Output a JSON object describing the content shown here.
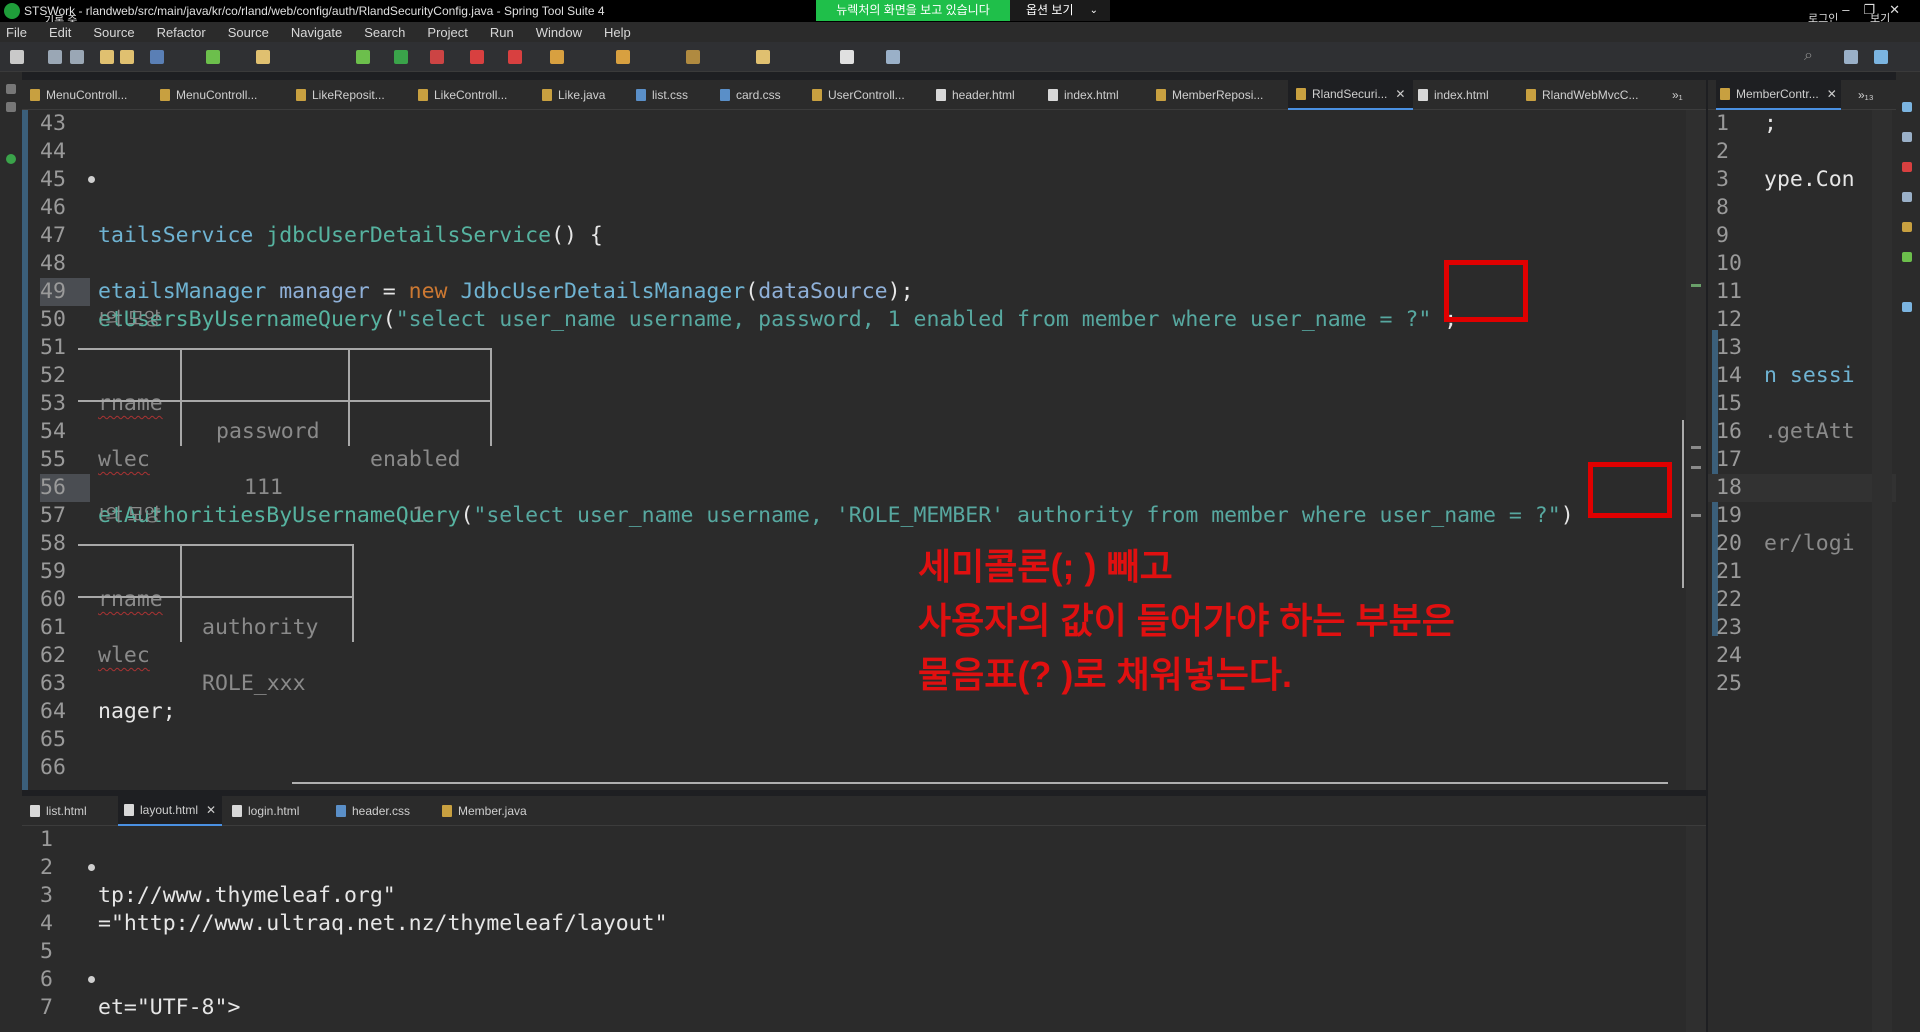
{
  "window": {
    "recording_label": "기록 중",
    "title": "STSWork - rlandweb/src/main/java/kr/co/rland/web/config/auth/RlandSecurityConfig.java - Spring Tool Suite 4",
    "share_banner": "뉴렉처의 화면을 보고 있습니다",
    "options_label": "옵션 보기",
    "login_label": "로그인",
    "view_label": "보기"
  },
  "menu": [
    "File",
    "Edit",
    "Source",
    "Refactor",
    "Source",
    "Navigate",
    "Search",
    "Project",
    "Run",
    "Window",
    "Help"
  ],
  "main_tabs": [
    "MenuControll...",
    "MenuControll...",
    "LikeReposit...",
    "LikeControll...",
    "Like.java",
    "list.css",
    "card.css",
    "UserControll...",
    "header.html",
    "index.html",
    "MemberReposi...",
    "RlandSecuri...",
    "index.html",
    "RlandWebMvcC..."
  ],
  "main_tabs_overflow": "»₁",
  "right_tabs": [
    "MemberContr..."
  ],
  "right_tabs_overflow": "»₁₃",
  "bottom_tabs": [
    "list.html",
    "layout.html",
    "login.html",
    "header.css",
    "Member.java"
  ],
  "main_editor": {
    "line_numbers": [
      "43",
      "44",
      "45",
      "46",
      "47",
      "48",
      "49",
      "50",
      "51",
      "52",
      "53",
      "54",
      "55",
      "56",
      "57",
      "58",
      "59",
      "60",
      "61",
      "62",
      "63",
      "64",
      "65",
      "66"
    ],
    "line46": {
      "p1": "tailsService ",
      "p2": "jdbcUserDetailsService",
      "p3": "() {"
    },
    "line48": {
      "p1": "etailsManager ",
      "p2": "manager",
      "p3": " = ",
      "p4": "new ",
      "p5": "JdbcUserDetailsManager",
      "p6": "(",
      "p7": "dataSource",
      "p8": ");"
    },
    "line49": {
      "p1": "etUsersByUsernameQuery",
      "p2": "(",
      "p3": "\"select user_name username, password, 1 enabled from member where user_name = ?\"",
      "p4": " ;"
    },
    "line50": "!의 모양",
    "line52": {
      "a": "rname",
      "b": "password",
      "c": "enabled"
    },
    "line54": {
      "a": "wlec",
      "b": "111",
      "c": "1"
    },
    "line56": {
      "p1": "etAuthoritiesByUsernameQuery",
      "p2": "(",
      "p3": "\"select user_name username, 'ROLE_MEMBER' authority from member where user_name = ?\"",
      "p4": ")"
    },
    "line57": "!의 모양",
    "line59": {
      "a": "rname",
      "b": "authority"
    },
    "line61": {
      "a": "wlec",
      "b": "ROLE_xxx"
    },
    "line64": "nager;"
  },
  "right_editor": {
    "line_numbers": [
      "1",
      "2",
      "3",
      "8",
      "9",
      "10",
      "11",
      "12",
      "13",
      "14",
      "15",
      "16",
      "17",
      "18",
      "19",
      "20",
      "21",
      "22",
      "23",
      "24",
      "25"
    ],
    "snippets": {
      "l1": ";",
      "l3": "ype.Con",
      "l14": "n sessi",
      "l16": ".getAtt",
      "l20": "er/logi"
    }
  },
  "bottom_editor": {
    "line_numbers": [
      "1",
      "2",
      "3",
      "4",
      "5",
      "6",
      "7"
    ],
    "line3": "tp://www.thymeleaf.org\"",
    "line4": "=\"http://www.ultraq.net.nz/thymeleaf/layout\"",
    "line7": "et=\"UTF-8\">"
  },
  "annotation": {
    "line1": "세미콜론(; ) 빼고",
    "line2": "사용자의 값이 들어가야 하는 부분은",
    "line3": "물음표(? )로 채워넣는다."
  },
  "colors": {
    "annotation_red": "#e00000",
    "share_green": "#1fbf4a",
    "string_teal": "#57a8a0",
    "keyword_orange": "#cc7832"
  }
}
